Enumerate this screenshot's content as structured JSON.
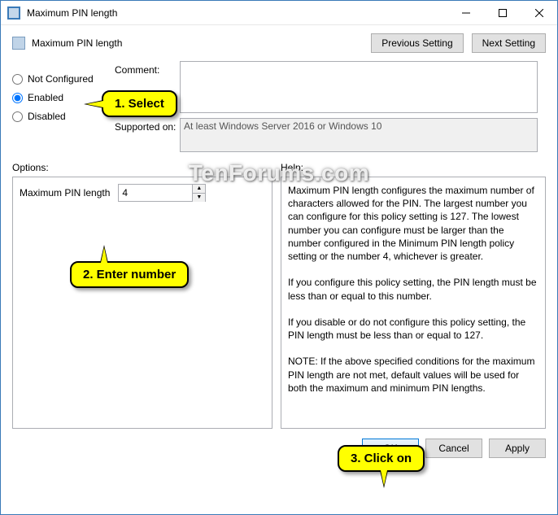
{
  "window": {
    "title": "Maximum PIN length",
    "minimize": "🗕",
    "maximize": "🗖",
    "close": "🗙"
  },
  "header": {
    "title": "Maximum PIN length",
    "prev": "Previous Setting",
    "next": "Next Setting"
  },
  "radios": {
    "not_configured": "Not Configured",
    "enabled": "Enabled",
    "disabled": "Disabled",
    "selected": "enabled"
  },
  "fields": {
    "comment_label": "Comment:",
    "comment_value": "",
    "supported_label": "Supported on:",
    "supported_value": "At least Windows Server 2016 or Windows 10"
  },
  "labels": {
    "options": "Options:",
    "help": "Help:"
  },
  "options": {
    "max_pin_label": "Maximum PIN length",
    "max_pin_value": "4"
  },
  "help": {
    "p1": "Maximum PIN length configures the maximum number of characters allowed for the PIN.  The largest number you can configure for this policy setting is 127. The lowest number you can configure must be larger than the number configured in the Minimum PIN length policy setting or the number 4, whichever is greater.",
    "p2": "If you configure this policy setting, the PIN length must be less than or equal to this number.",
    "p3": "If you disable or do not configure this policy setting, the PIN length must be less than or equal to 127.",
    "p4": "NOTE: If the above specified conditions for the maximum PIN length are not met, default values will be used for both the maximum and minimum PIN lengths."
  },
  "buttons": {
    "ok": "OK",
    "cancel": "Cancel",
    "apply": "Apply"
  },
  "callouts": {
    "c1": "1. Select",
    "c2": "2. Enter number",
    "c3": "3. Click on"
  },
  "watermark": "TenForums.com"
}
